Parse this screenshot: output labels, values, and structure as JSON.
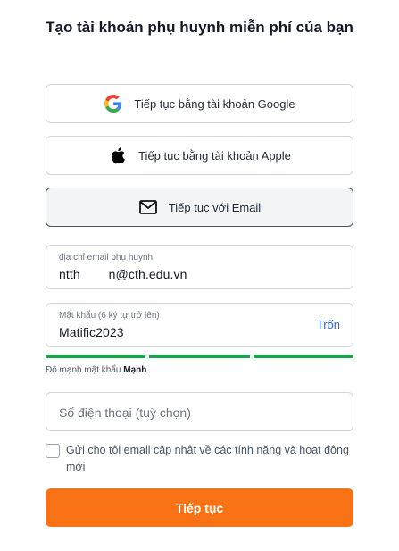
{
  "page": {
    "title": "Tạo tài khoản phụ huynh miễn phí của bạn"
  },
  "auth_buttons": {
    "google": "Tiếp tục bằng tài khoản Google",
    "apple": "Tiếp tục bằng tài khoản Apple",
    "email": "Tiếp tục với Email"
  },
  "form": {
    "email": {
      "label": "địa chỉ email phụ huynh",
      "value": "ntth        n@cth.edu.vn"
    },
    "password": {
      "label": "Mật khẩu (6 ký tự trở lên)",
      "value": "Matific2023",
      "toggle": "Trốn"
    },
    "strength": {
      "label": "Độ mạnh mật khẩu",
      "value": "Mạnh",
      "level": 1.0,
      "color": "#16a34a"
    },
    "phone": {
      "placeholder": "Số điện thoại (tuỳ chọn)"
    },
    "updates_checkbox": {
      "label": "Gửi cho tôi email cập nhật về các tính năng và hoạt động mới",
      "checked": false
    },
    "submit": "Tiếp tục"
  },
  "icons": [
    "google-icon",
    "apple-icon",
    "mail-icon"
  ],
  "colors": {
    "accent": "#f97316",
    "link": "#2563eb",
    "strength": "#16a34a"
  }
}
